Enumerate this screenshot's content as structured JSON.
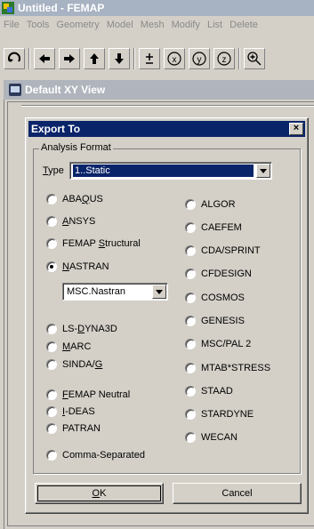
{
  "app": {
    "title": "Untitled - FEMAP"
  },
  "menu": [
    "File",
    "Tools",
    "Geometry",
    "Model",
    "Mesh",
    "Modify",
    "List",
    "Delete"
  ],
  "toolbar": {
    "icons": [
      "rotate-icon",
      "arrow-left-icon",
      "arrow-right-icon",
      "arrow-up-icon",
      "arrow-down-icon",
      "plus-minus-icon",
      "rotate-x-icon",
      "rotate-y-icon",
      "rotate-z-icon",
      "zoom-in-icon"
    ]
  },
  "view": {
    "title": "Default XY View"
  },
  "dialog": {
    "title": "Export To",
    "close": "×",
    "group_label": "Analysis Format",
    "type_label_pre": "",
    "type_label_hot": "T",
    "type_label_post": "ype",
    "type_value": "1..Static",
    "sub_value": "MSC.Nastran",
    "left_options": [
      {
        "pre": "ABA",
        "hot": "Q",
        "post": "US",
        "checked": false
      },
      {
        "pre": "",
        "hot": "A",
        "post": "NSYS",
        "checked": false
      },
      {
        "pre": "FEMAP ",
        "hot": "S",
        "post": "tructural",
        "checked": false
      },
      {
        "pre": "",
        "hot": "N",
        "post": "ASTRAN",
        "checked": true
      },
      {
        "pre": "LS-",
        "hot": "D",
        "post": "YNA3D",
        "checked": false
      },
      {
        "pre": "",
        "hot": "M",
        "post": "ARC",
        "checked": false
      },
      {
        "pre": "SINDA/",
        "hot": "G",
        "post": "",
        "checked": false
      },
      {
        "pre": "",
        "hot": "F",
        "post": "EMAP Neutral",
        "checked": false
      },
      {
        "pre": "",
        "hot": "I",
        "post": "-DEAS",
        "checked": false
      },
      {
        "pre": "PATRAN",
        "hot": "",
        "post": "",
        "checked": false
      },
      {
        "pre": "Comma-Separated",
        "hot": "",
        "post": "",
        "checked": false
      }
    ],
    "right_options": [
      "ALGOR",
      "CAEFEM",
      "CDA/SPRINT",
      "CFDESIGN",
      "COSMOS",
      "GENESIS",
      "MSC/PAL 2",
      "MTAB*STRESS",
      "STAAD",
      "STARDYNE",
      "WECAN"
    ],
    "ok_hot": "O",
    "ok_post": "K",
    "cancel": "Cancel"
  }
}
